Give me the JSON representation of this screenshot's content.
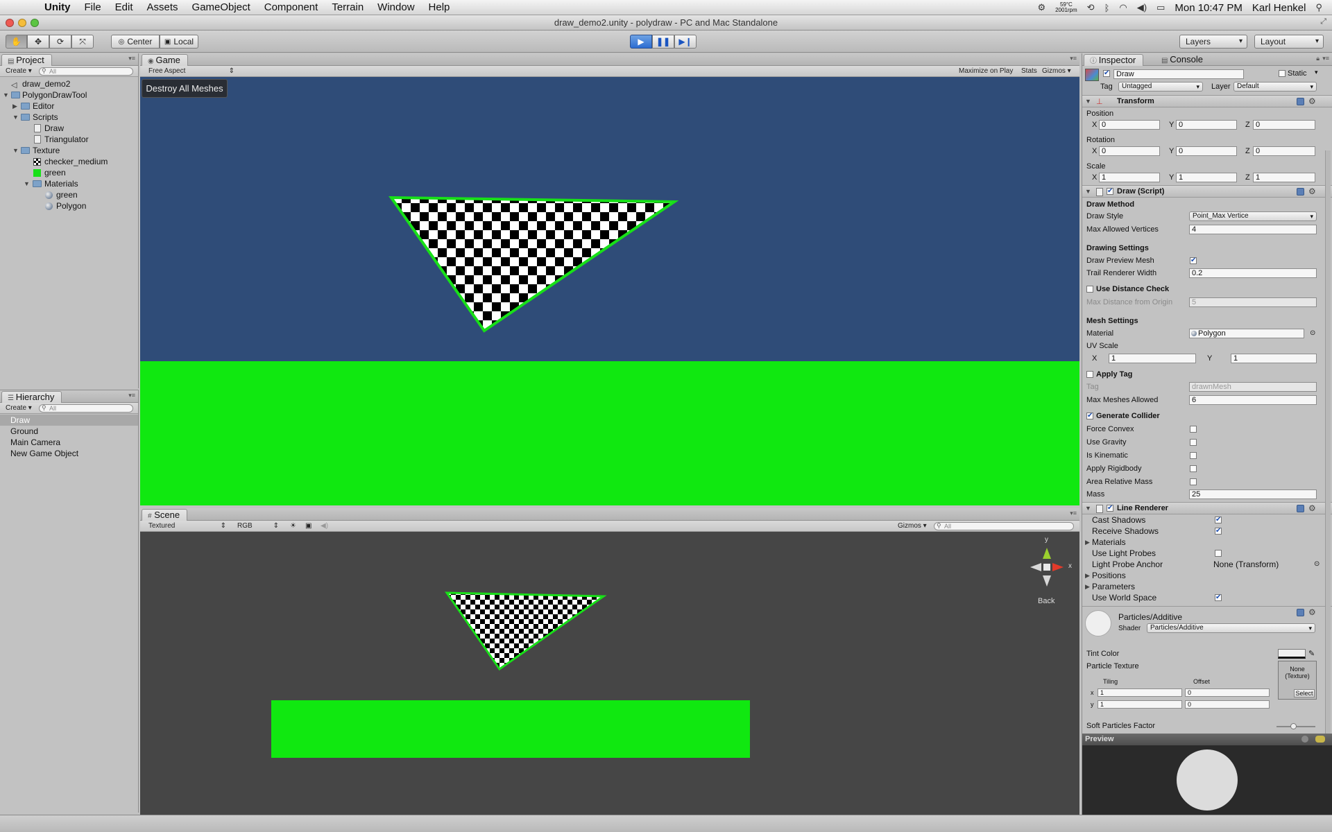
{
  "menubar": {
    "menus": [
      "Unity",
      "File",
      "Edit",
      "Assets",
      "GameObject",
      "Component",
      "Terrain",
      "Window",
      "Help"
    ],
    "temp_line1": "59°C",
    "temp_line2": "2001rpm",
    "clock": "Mon 10:47 PM",
    "user": "Karl Henkel"
  },
  "window": {
    "title": "draw_demo2.unity - polydraw - PC and Mac Standalone"
  },
  "toolbar": {
    "pivot_label": "Center",
    "space_label": "Local",
    "layers_label": "Layers",
    "layout_label": "Layout"
  },
  "project": {
    "tab_label": "Project",
    "create_label": "Create",
    "search_placeholder": "All",
    "items": [
      "draw_demo2",
      "PolygonDrawTool",
      "Editor",
      "Scripts",
      "Draw",
      "Triangulator",
      "Texture",
      "checker_medium",
      "green",
      "Materials",
      "green",
      "Polygon"
    ]
  },
  "hierarchy": {
    "tab_label": "Hierarchy",
    "create_label": "Create",
    "search_placeholder": "All",
    "items": [
      "Draw",
      "Ground",
      "Main Camera",
      "New Game Object"
    ]
  },
  "game": {
    "tab_label": "Game",
    "aspect_label": "Free Aspect",
    "maximize_label": "Maximize on Play",
    "stats_label": "Stats",
    "gizmos_label": "Gizmos",
    "destroy_button": "Destroy All Meshes",
    "bg_color": "#2f4c78",
    "ground_color": "#10e810"
  },
  "scene": {
    "tab_label": "Scene",
    "render_mode": "Textured",
    "color_mode": "RGB",
    "gizmos_label": "Gizmos",
    "search_placeholder": "All",
    "gizmo_y": "y",
    "gizmo_x": "x",
    "view_label": "Back",
    "bg_color": "#464646"
  },
  "inspector": {
    "tab_label": "Inspector",
    "console_tab": "Console",
    "object_name": "Draw",
    "static_label": "Static",
    "tag_label": "Tag",
    "tag_value": "Untagged",
    "layer_label": "Layer",
    "layer_value": "Default",
    "transform": {
      "title": "Transform",
      "position_label": "Position",
      "rotation_label": "Rotation",
      "scale_label": "Scale",
      "x": "X",
      "y": "Y",
      "z": "Z",
      "position": [
        "0",
        "0",
        "0"
      ],
      "rotation": [
        "0",
        "0",
        "0"
      ],
      "scale": [
        "1",
        "1",
        "1"
      ]
    },
    "draw_script": {
      "title": "Draw (Script)",
      "draw_method": "Draw Method",
      "draw_style_label": "Draw Style",
      "draw_style_value": "Point_Max Vertice",
      "max_vertices_label": "Max Allowed Vertices",
      "max_vertices_value": "4",
      "drawing_settings": "Drawing Settings",
      "preview_mesh_label": "Draw Preview Mesh",
      "trail_width_label": "Trail Renderer Width",
      "trail_width_value": "0.2",
      "distance_check_label": "Use Distance Check",
      "max_distance_label": "Max Distance from Origin",
      "max_distance_value": "5",
      "mesh_settings": "Mesh Settings",
      "material_label": "Material",
      "material_value": "Polygon",
      "uv_scale_label": "UV Scale",
      "uv_x_label": "X",
      "uv_x_value": "1",
      "uv_y_label": "Y",
      "uv_y_value": "1",
      "apply_tag_label": "Apply Tag",
      "tag_label": "Tag",
      "tag_value": "drawnMesh",
      "max_meshes_label": "Max Meshes Allowed",
      "max_meshes_value": "6",
      "generate_collider_label": "Generate Collider",
      "force_convex_label": "Force Convex",
      "use_gravity_label": "Use Gravity",
      "is_kinematic_label": "Is Kinematic",
      "apply_rigidbody_label": "Apply Rigidbody",
      "area_mass_label": "Area Relative Mass",
      "mass_label": "Mass",
      "mass_value": "25"
    },
    "line_renderer": {
      "title": "Line Renderer",
      "cast_shadows": "Cast Shadows",
      "receive_shadows": "Receive Shadows",
      "materials": "Materials",
      "light_probes": "Use Light Probes",
      "probe_anchor": "Light Probe Anchor",
      "probe_anchor_value": "None (Transform)",
      "positions": "Positions",
      "parameters": "Parameters",
      "world_space": "Use World Space"
    },
    "material": {
      "name": "Particles/Additive",
      "shader_label": "Shader",
      "shader_value": "Particles/Additive",
      "tint_label": "Tint Color",
      "texture_label": "Particle Texture",
      "texture_none": "None (Texture)",
      "select_label": "Select",
      "tiling_label": "Tiling",
      "offset_label": "Offset",
      "x_label": "x",
      "y_label": "y",
      "tiling_x": "1",
      "tiling_y": "1",
      "offset_x": "0",
      "offset_y": "0",
      "soft_label": "Soft Particles Factor"
    },
    "preview_label": "Preview"
  }
}
